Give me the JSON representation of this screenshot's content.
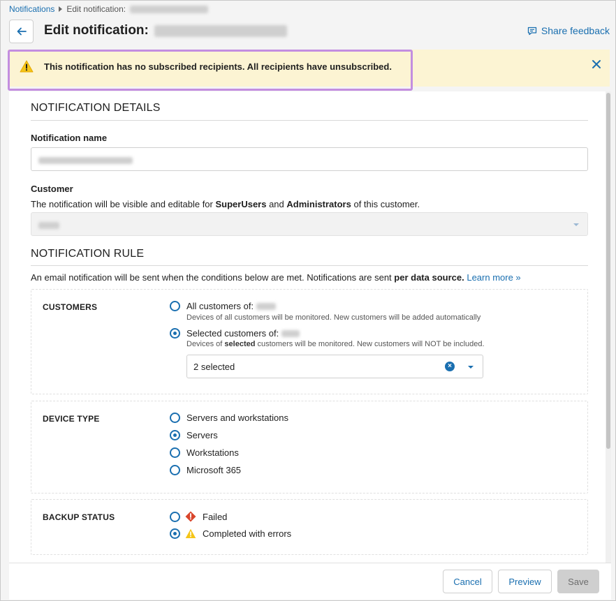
{
  "breadcrumb": {
    "root": "Notifications",
    "current": "Edit notification:"
  },
  "header": {
    "title": "Edit notification:",
    "feedback": "Share feedback"
  },
  "banner": {
    "message": "This notification has no subscribed recipients. All recipients have unsubscribed."
  },
  "details": {
    "section_title": "NOTIFICATION DETAILS",
    "name_label": "Notification name",
    "customer_label": "Customer",
    "customer_help_pre": "The notification will be visible and editable for ",
    "customer_help_b1": "SuperUsers",
    "customer_help_mid": " and ",
    "customer_help_b2": "Administrators",
    "customer_help_post": " of this customer."
  },
  "rule": {
    "section_title": "NOTIFICATION RULE",
    "intro_pre": "An email notification will be sent when the conditions below are met. Notifications are sent ",
    "intro_bold": "per data source.",
    "learn_more": "Learn more »"
  },
  "customers": {
    "label": "CUSTOMERS",
    "opt_all": "All customers of:",
    "opt_all_hint": "Devices of all customers will be monitored. New customers will be added automatically",
    "opt_selected": "Selected customers of:",
    "opt_selected_hint_pre": "Devices of ",
    "opt_selected_hint_bold": "selected",
    "opt_selected_hint_post": " customers will be monitored. New customers will NOT be included.",
    "multiselect_value": "2 selected"
  },
  "device_type": {
    "label": "DEVICE TYPE",
    "options": [
      "Servers and workstations",
      "Servers",
      "Workstations",
      "Microsoft 365"
    ],
    "selected_index": 1
  },
  "backup_status": {
    "label": "BACKUP STATUS",
    "options": [
      "Failed",
      "Completed with errors"
    ],
    "selected_index": 1
  },
  "footer": {
    "cancel": "Cancel",
    "preview": "Preview",
    "save": "Save"
  },
  "colors": {
    "accent": "#1a6fb0",
    "banner_bg": "#fcf4d3",
    "highlight_outline": "#c38ee0",
    "failed": "#d9452b",
    "warning": "#f5c518"
  },
  "icons": {
    "back": "arrow-left-icon",
    "feedback": "comment-icon",
    "banner": "warning-triangle-icon",
    "close": "close-icon",
    "failed": "failed-diamond-icon",
    "completed_with_errors": "warning-triangle-icon"
  }
}
